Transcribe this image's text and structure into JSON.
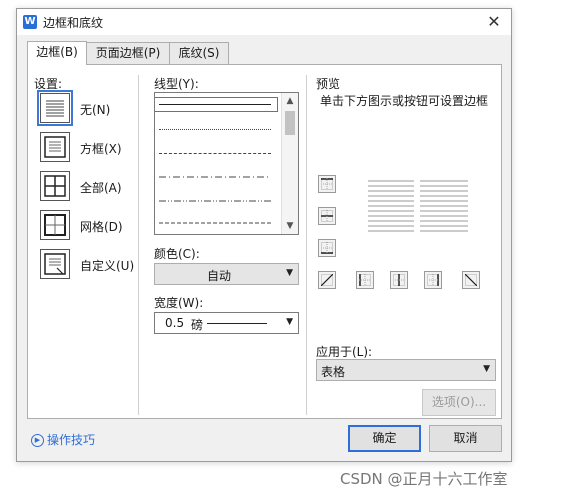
{
  "window": {
    "title": "边框和底纹",
    "app_icon": "W"
  },
  "tabs": [
    {
      "label": "边框(B)",
      "active": true
    },
    {
      "label": "页面边框(P)",
      "active": false
    },
    {
      "label": "底纹(S)",
      "active": false
    }
  ],
  "settings": {
    "label": "设置:",
    "items": [
      {
        "label": "无(N)",
        "icon": "border-none-icon",
        "selected": true
      },
      {
        "label": "方框(X)",
        "icon": "border-box-icon",
        "selected": false
      },
      {
        "label": "全部(A)",
        "icon": "border-all-icon",
        "selected": false
      },
      {
        "label": "网格(D)",
        "icon": "border-grid-icon",
        "selected": false
      },
      {
        "label": "自定义(U)",
        "icon": "border-custom-icon",
        "selected": false
      }
    ]
  },
  "style": {
    "label": "线型(Y):",
    "options": [
      "solid",
      "dotted-fine",
      "dashed-small",
      "dash-dot",
      "dash-dot-dot",
      "dashed-long"
    ],
    "selected_index": 0
  },
  "color": {
    "label": "颜色(C):",
    "value": "自动"
  },
  "width": {
    "label": "宽度(W):",
    "value": "0.5",
    "unit": "磅"
  },
  "preview": {
    "label": "预览",
    "hint": "单击下方图示或按钮可设置边框",
    "buttons": [
      "top-border-icon",
      "inside-horizontal-border-icon",
      "bottom-border-icon",
      "diagonal-up-icon",
      "left-border-icon",
      "inside-vertical-border-icon",
      "right-border-icon",
      "diagonal-down-icon"
    ]
  },
  "apply_to": {
    "label": "应用于(L):",
    "value": "表格"
  },
  "options_button": "选项(O)...",
  "footer": {
    "tips": "操作技巧",
    "ok": "确定",
    "cancel": "取消"
  },
  "watermark": "CSDN @正月十六工作室",
  "colors": {
    "accent": "#2f6ed7",
    "panel_bg": "#ffffff",
    "dialog_bg": "#f0f0f0"
  }
}
